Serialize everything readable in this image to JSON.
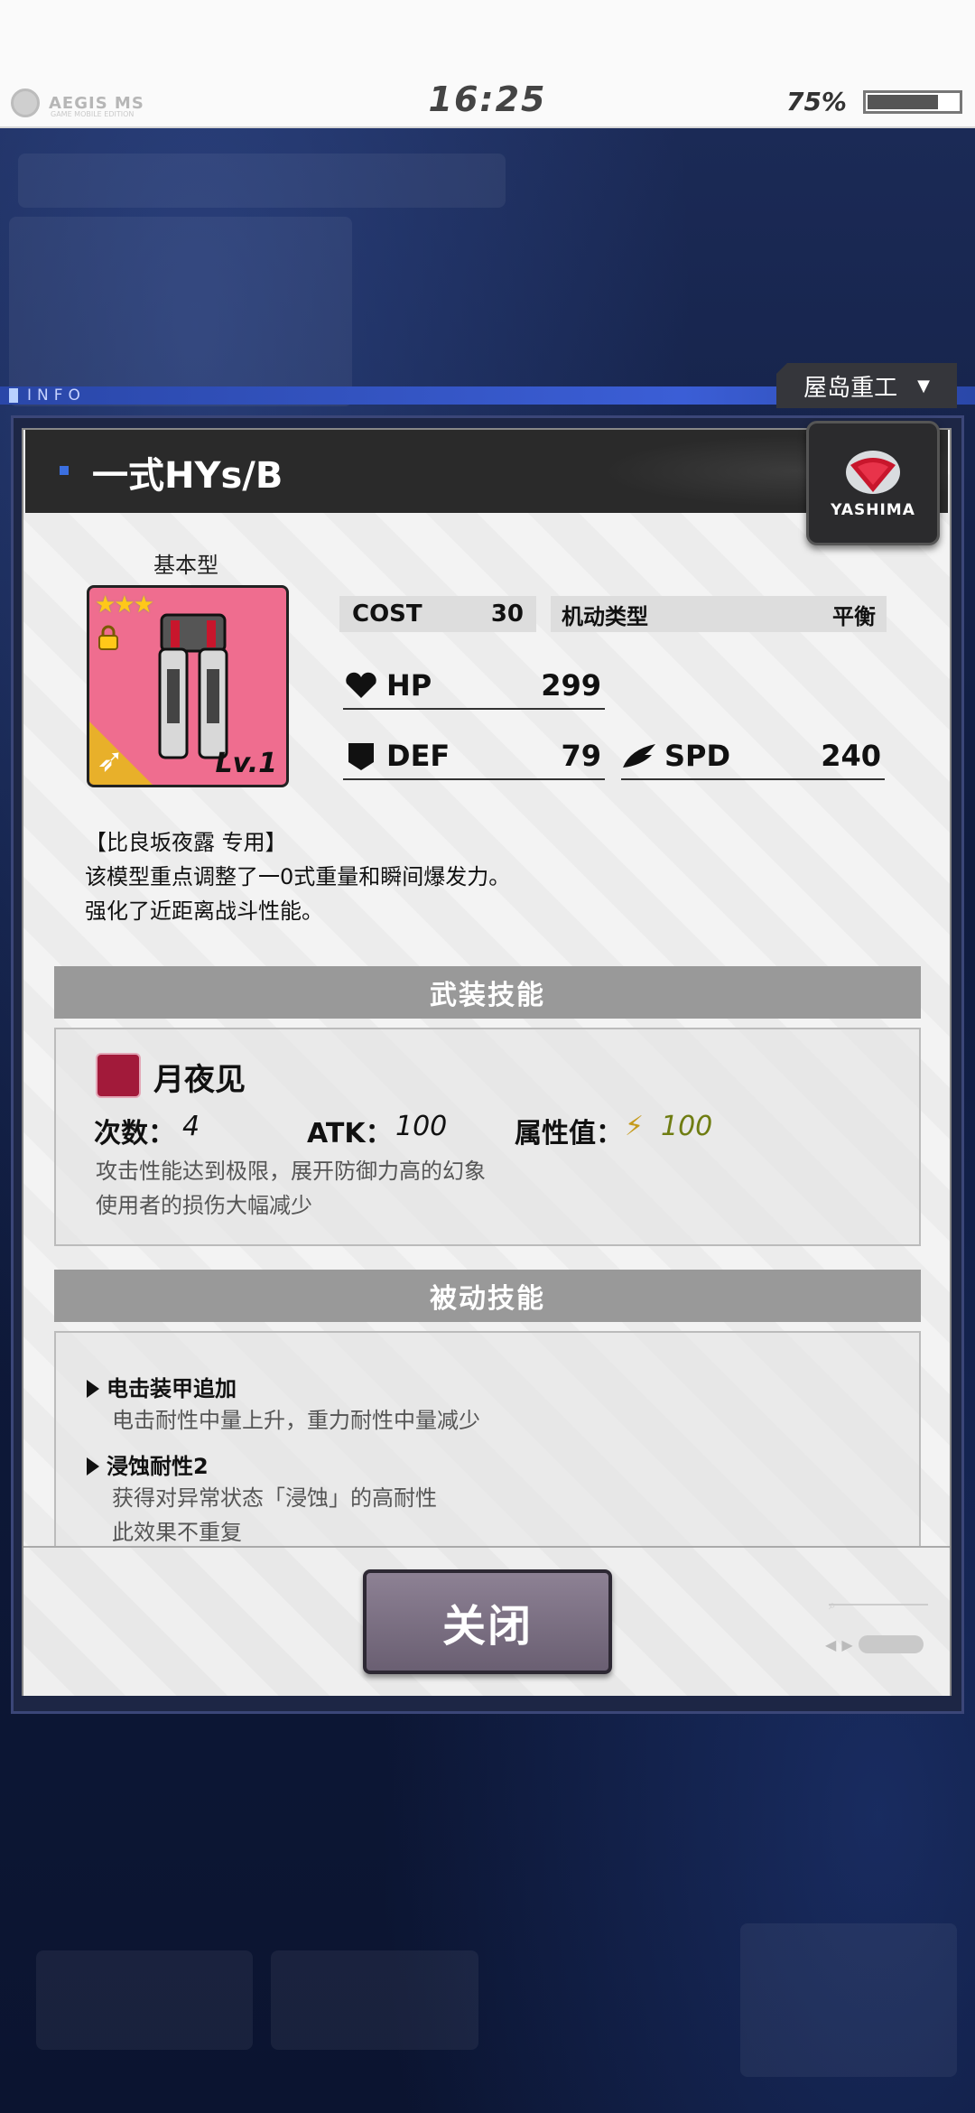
{
  "status_bar": {
    "app_logo_text": "AEGIS MS",
    "app_logo_sub": "GAME MOBILE EDITION",
    "time": "16:25",
    "battery_percent": "75%",
    "battery_level": 0.75
  },
  "info_label": "INFO",
  "maker_tab": {
    "label": "屋岛重工",
    "arrow": "▼"
  },
  "unit": {
    "name": "一式HYs/B",
    "brand": "YASHIMA",
    "type_label": "基本型",
    "stars": "★★★",
    "level": "Lv.1"
  },
  "stats": {
    "cost_label": "COST",
    "cost_value": "30",
    "mobility_label": "机动类型",
    "mobility_value": "平衡",
    "hp_label": "HP",
    "hp_value": "299",
    "def_label": "DEF",
    "def_value": "79",
    "spd_label": "SPD",
    "spd_value": "240"
  },
  "description": {
    "line1": "【比良坂夜露 专用】",
    "line2": "该模型重点调整了一0式重量和瞬间爆发力。",
    "line3": "强化了近距离战斗性能。"
  },
  "weapon_skill": {
    "header": "武装技能",
    "name": "月夜见",
    "uses_label": "次数：",
    "uses_value": "4",
    "atk_label": "ATK：",
    "atk_value": "100",
    "attr_label": "属性值：",
    "attr_value": "100",
    "desc1": "攻击性能达到极限，展开防御力高的幻象",
    "desc2": "使用者的损伤大幅减少"
  },
  "passive_skill": {
    "header": "被动技能",
    "items": [
      {
        "name": "电击装甲追加",
        "desc": [
          "电击耐性中量上升，重力耐性中量减少"
        ]
      },
      {
        "name": "浸蚀耐性2",
        "desc": [
          "获得对异常状态「浸蚀」的高耐性",
          "此效果不重复"
        ]
      }
    ]
  },
  "close_button": "关闭",
  "colors": {
    "title_bar": "#2a2a2a",
    "section_header": "#999999",
    "unit_card": "#ef6d8f",
    "attr_accent": "#6f7d12",
    "info_strip": "#3b5ed6"
  }
}
